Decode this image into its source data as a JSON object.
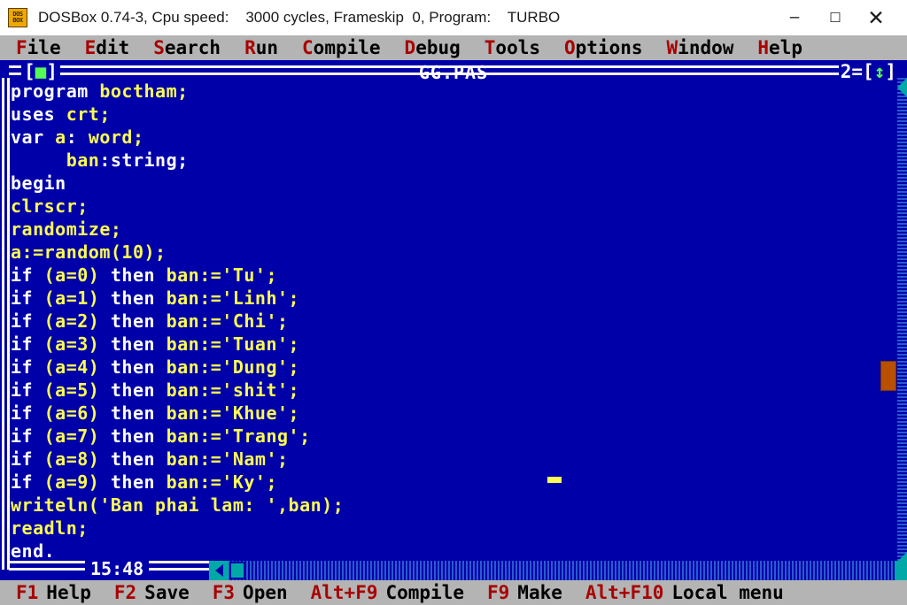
{
  "window": {
    "icon_line1": "DOS",
    "icon_line2": "BOX",
    "title": "DOSBox 0.74-3, Cpu speed:    3000 cycles, Frameskip  0, Program:    TURBO",
    "minimize": "–",
    "maximize": "☐",
    "close": "✕"
  },
  "menubar": {
    "items": [
      {
        "hotkey": "F",
        "rest": "ile"
      },
      {
        "hotkey": "E",
        "rest": "dit"
      },
      {
        "hotkey": "S",
        "rest": "earch"
      },
      {
        "hotkey": "R",
        "rest": "un"
      },
      {
        "hotkey": "C",
        "rest": "ompile"
      },
      {
        "hotkey": "D",
        "rest": "ebug"
      },
      {
        "hotkey": "T",
        "rest": "ools"
      },
      {
        "hotkey": "O",
        "rest": "ptions"
      },
      {
        "hotkey": "W",
        "rest": "indow"
      },
      {
        "hotkey": "H",
        "rest": "elp"
      }
    ]
  },
  "editor": {
    "title": "GG.PAS",
    "close_box_left": "[",
    "close_box_square": "■",
    "close_box_right": "]",
    "window_number": "2=[",
    "zoom_arrow": "↕",
    "zoom_right": "]",
    "clock": "15:48",
    "lines": [
      [
        {
          "t": "program ",
          "c": "kw"
        },
        {
          "t": "boctham;",
          "c": "id"
        }
      ],
      [
        {
          "t": "uses ",
          "c": "kw"
        },
        {
          "t": "crt;",
          "c": "id"
        }
      ],
      [
        {
          "t": "var ",
          "c": "kw"
        },
        {
          "t": "a",
          "c": "id"
        },
        {
          "t": ": ",
          "c": "kw"
        },
        {
          "t": "word;",
          "c": "id"
        }
      ],
      [
        {
          "t": "     ",
          "c": "kw"
        },
        {
          "t": "ban",
          "c": "id"
        },
        {
          "t": ":string;",
          "c": "kw"
        }
      ],
      [
        {
          "t": "begin",
          "c": "kw"
        }
      ],
      [
        {
          "t": "clrscr;",
          "c": "id"
        }
      ],
      [
        {
          "t": "randomize;",
          "c": "id"
        }
      ],
      [
        {
          "t": "a:=random(10);",
          "c": "id"
        }
      ],
      [
        {
          "t": "if ",
          "c": "kw"
        },
        {
          "t": "(a=0) ",
          "c": "id"
        },
        {
          "t": "then ",
          "c": "kw"
        },
        {
          "t": "ban:='Tu';",
          "c": "id"
        }
      ],
      [
        {
          "t": "if ",
          "c": "kw"
        },
        {
          "t": "(a=1) ",
          "c": "id"
        },
        {
          "t": "then ",
          "c": "kw"
        },
        {
          "t": "ban:='Linh';",
          "c": "id"
        }
      ],
      [
        {
          "t": "if ",
          "c": "kw"
        },
        {
          "t": "(a=2) ",
          "c": "id"
        },
        {
          "t": "then ",
          "c": "kw"
        },
        {
          "t": "ban:='Chi';",
          "c": "id"
        }
      ],
      [
        {
          "t": "if ",
          "c": "kw"
        },
        {
          "t": "(a=3) ",
          "c": "id"
        },
        {
          "t": "then ",
          "c": "kw"
        },
        {
          "t": "ban:='Tuan';",
          "c": "id"
        }
      ],
      [
        {
          "t": "if ",
          "c": "kw"
        },
        {
          "t": "(a=4) ",
          "c": "id"
        },
        {
          "t": "then ",
          "c": "kw"
        },
        {
          "t": "ban:='Dung';",
          "c": "id"
        }
      ],
      [
        {
          "t": "if ",
          "c": "kw"
        },
        {
          "t": "(a=5) ",
          "c": "id"
        },
        {
          "t": "then ",
          "c": "kw"
        },
        {
          "t": "ban:='shit';",
          "c": "id"
        }
      ],
      [
        {
          "t": "if ",
          "c": "kw"
        },
        {
          "t": "(a=6) ",
          "c": "id"
        },
        {
          "t": "then ",
          "c": "kw"
        },
        {
          "t": "ban:='Khue';",
          "c": "id"
        }
      ],
      [
        {
          "t": "if ",
          "c": "kw"
        },
        {
          "t": "(a=7) ",
          "c": "id"
        },
        {
          "t": "then ",
          "c": "kw"
        },
        {
          "t": "ban:='Trang';",
          "c": "id"
        }
      ],
      [
        {
          "t": "if ",
          "c": "kw"
        },
        {
          "t": "(a=8) ",
          "c": "id"
        },
        {
          "t": "then ",
          "c": "kw"
        },
        {
          "t": "ban:='Nam';",
          "c": "id"
        }
      ],
      [
        {
          "t": "if ",
          "c": "kw"
        },
        {
          "t": "(a=9) ",
          "c": "id"
        },
        {
          "t": "then ",
          "c": "kw"
        },
        {
          "t": "ban:='Ky';",
          "c": "id"
        }
      ],
      [
        {
          "t": "writeln('Ban phai lam: ',ban);",
          "c": "id"
        }
      ],
      [
        {
          "t": "readln;",
          "c": "id"
        }
      ],
      [
        {
          "t": "end.",
          "c": "kw"
        }
      ]
    ]
  },
  "statusbar": {
    "items": [
      {
        "key": "F1",
        "label": "Help"
      },
      {
        "key": "F2",
        "label": "Save"
      },
      {
        "key": "F3",
        "label": "Open"
      },
      {
        "key": "Alt+F9",
        "label": "Compile"
      },
      {
        "key": "F9",
        "label": "Make"
      },
      {
        "key": "Alt+F10",
        "label": "Local menu"
      }
    ]
  },
  "colors": {
    "dos_blue": "#0000a8",
    "keyword_white": "#ffffff",
    "identifier_yellow": "#fcfc54",
    "menu_gray": "#b4b4b4",
    "hotkey_red": "#a80000",
    "accent_green": "#54fc54",
    "scroll_cyan": "#00a8a8",
    "thumb_orange": "#b85000"
  }
}
